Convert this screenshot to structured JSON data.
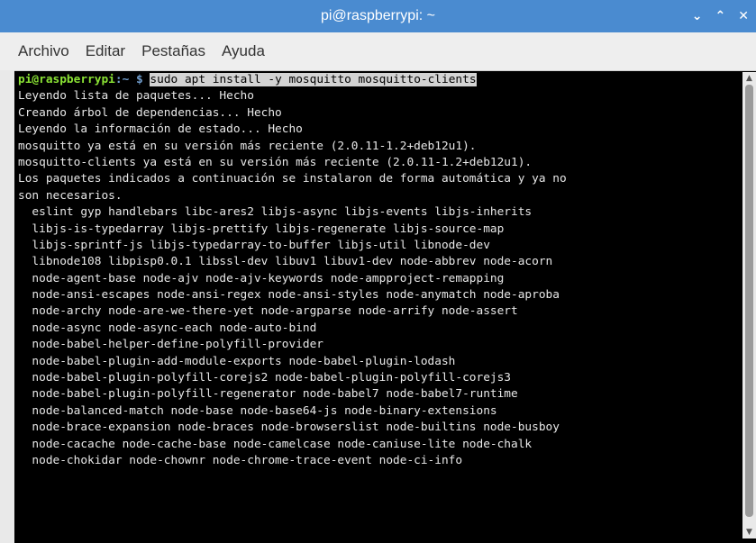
{
  "window": {
    "title": "pi@raspberrypi: ~",
    "buttons": [
      "⌄",
      "⌃",
      "✕"
    ]
  },
  "menu": [
    "Archivo",
    "Editar",
    "Pestañas",
    "Ayuda"
  ],
  "prompt": {
    "user_host": "pi@raspberrypi",
    "path": ":~ $",
    "command": "sudo apt install -y mosquitto mosquitto-clients"
  },
  "output": [
    "Leyendo lista de paquetes... Hecho",
    "Creando árbol de dependencias... Hecho",
    "Leyendo la información de estado... Hecho",
    "mosquitto ya está en su versión más reciente (2.0.11-1.2+deb12u1).",
    "mosquitto-clients ya está en su versión más reciente (2.0.11-1.2+deb12u1).",
    "Los paquetes indicados a continuación se instalaron de forma automática y ya no",
    "son necesarios.",
    "  eslint gyp handlebars libc-ares2 libjs-async libjs-events libjs-inherits",
    "  libjs-is-typedarray libjs-prettify libjs-regenerate libjs-source-map",
    "  libjs-sprintf-js libjs-typedarray-to-buffer libjs-util libnode-dev",
    "  libnode108 libpisp0.0.1 libssl-dev libuv1 libuv1-dev node-abbrev node-acorn",
    "  node-agent-base node-ajv node-ajv-keywords node-ampproject-remapping",
    "  node-ansi-escapes node-ansi-regex node-ansi-styles node-anymatch node-aproba",
    "  node-archy node-are-we-there-yet node-argparse node-arrify node-assert",
    "  node-async node-async-each node-auto-bind",
    "  node-babel-helper-define-polyfill-provider",
    "  node-babel-plugin-add-module-exports node-babel-plugin-lodash",
    "  node-babel-plugin-polyfill-corejs2 node-babel-plugin-polyfill-corejs3",
    "  node-babel-plugin-polyfill-regenerator node-babel7 node-babel7-runtime",
    "  node-balanced-match node-base node-base64-js node-binary-extensions",
    "  node-brace-expansion node-braces node-browserslist node-builtins node-busboy",
    "  node-cacache node-cache-base node-camelcase node-caniuse-lite node-chalk",
    "  node-chokidar node-chownr node-chrome-trace-event node-ci-info"
  ]
}
